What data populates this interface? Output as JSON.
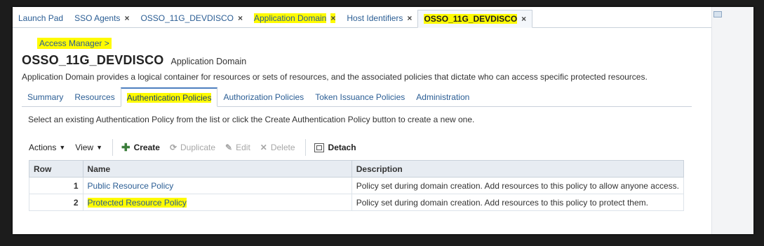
{
  "top_tabs": [
    {
      "label": "Launch Pad",
      "closable": false,
      "highlighted": false
    },
    {
      "label": "SSO Agents",
      "closable": true,
      "highlighted": false
    },
    {
      "label": "OSSO_11G_DEVDISCO",
      "closable": true,
      "highlighted": false
    },
    {
      "label": "Application Domain",
      "closable": true,
      "highlighted": true
    },
    {
      "label": "Host Identifiers",
      "closable": true,
      "highlighted": false
    },
    {
      "label": "OSSO_11G_DEVDISCO",
      "closable": true,
      "highlighted": true,
      "active": true
    }
  ],
  "breadcrumb": "Access Manager >",
  "title": "OSSO_11G_DEVDISCO",
  "subtitle": "Application Domain",
  "description": "Application Domain provides a logical container for resources or sets of resources, and the associated policies that dictate who can access specific protected resources.",
  "sub_tabs": [
    "Summary",
    "Resources",
    "Authentication Policies",
    "Authorization Policies",
    "Token Issuance Policies",
    "Administration"
  ],
  "active_sub_tab": "Authentication Policies",
  "hint": "Select an existing Authentication Policy from the list or click the Create Authentication Policy button to create a new one.",
  "toolbar": {
    "actions": "Actions",
    "view": "View",
    "create": "Create",
    "duplicate": "Duplicate",
    "edit": "Edit",
    "delete": "Delete",
    "detach": "Detach"
  },
  "table": {
    "headers": [
      "Row",
      "Name",
      "Description"
    ],
    "rows": [
      {
        "row": "1",
        "name": "Public Resource Policy",
        "description": "Policy set during domain creation. Add resources to this policy to allow anyone access."
      },
      {
        "row": "2",
        "name": "Protected Resource Policy",
        "description": "Policy set during domain creation. Add resources to this policy to protect them."
      }
    ]
  },
  "icons": {
    "close": "close-icon",
    "caret": "chevron-down-icon",
    "create": "plus-icon",
    "duplicate": "duplicate-icon",
    "edit": "pencil-icon",
    "delete": "x-icon",
    "detach": "detach-icon"
  },
  "colors": {
    "highlight": "#fffb00",
    "link": "#2a5d94",
    "header_bg": "#e7ecf2"
  }
}
